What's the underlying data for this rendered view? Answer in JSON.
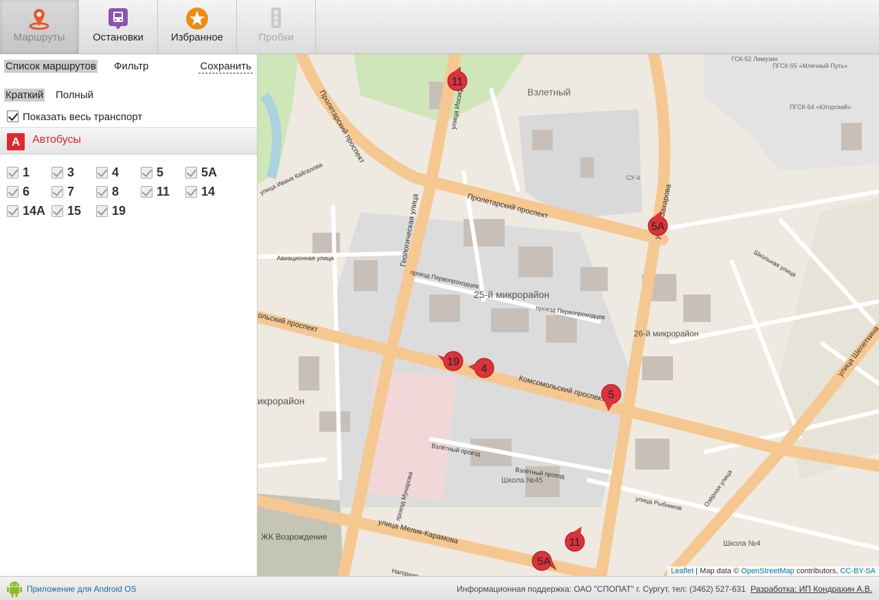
{
  "toolbar": {
    "tabs": [
      {
        "label": "Маршруты",
        "icon": "route-pin-icon"
      },
      {
        "label": "Остановки",
        "icon": "bus-stop-icon"
      },
      {
        "label": "Избранное",
        "icon": "star-icon"
      },
      {
        "label": "Пробки",
        "icon": "traffic-light-icon"
      }
    ]
  },
  "sidebar": {
    "list_tab": "Список маршрутов",
    "filter_tab": "Фильтр",
    "save_link": "Сохранить",
    "brief_tab": "Краткий",
    "full_tab": "Полный",
    "show_all_label": "Показать весь транспорт",
    "group": {
      "badge": "А",
      "name": "Автобусы"
    },
    "routes": [
      "1",
      "3",
      "4",
      "5",
      "5А",
      "6",
      "7",
      "8",
      "11",
      "14",
      "14А",
      "15",
      "19"
    ]
  },
  "map": {
    "labels": {
      "district_25": "25-й микрорайон",
      "district_26": "26-й микрорайон",
      "district_left": "икрорайон",
      "vzletny": "Взлетный",
      "proletarsky": "Пролетарский проспект",
      "proletarsky2": "Пролетарский проспект",
      "komsomolsky": "Комсомольский проспект",
      "komsomolsky_left": "ольский проспект",
      "geologicheskaya": "Геологическая улица",
      "zakharova": "улица Захарова",
      "melik": "улица Мелик-Карамова",
      "shepetkina": "улица Шепеткина",
      "aviatsionnaya": "Авиационная улица",
      "pervoprokhodtsev": "проезд Первопроходцев",
      "pervoprokhodtsev2": "проезд Первопроходцев",
      "vzletny_pr": "Взлётный проезд",
      "vzletny_pr2": "Взлётный проезд",
      "rybnikov": "улица Рыбников",
      "gsk52": "ГСК-52 Лимузин",
      "pgsk55": "ПГСК-55 «Млечный Путь»",
      "pgsk54": "ПГСК-54 «Югорский»",
      "zhk": "ЖК Возрождение",
      "school45": "Школа №45",
      "school4": "Школа №4",
      "su4": "СУ-4",
      "ozernaya": "Озёрная улица",
      "mukharova": "проезд Мунарова",
      "ioss": "улица Иосифа",
      "kaykalova": "улица Ивана Кайгалова",
      "shkolnaya": "Школьная улица",
      "nagornaya": "Нагорная"
    },
    "markers": [
      {
        "label": "11"
      },
      {
        "label": "5А"
      },
      {
        "label": "19"
      },
      {
        "label": "4"
      },
      {
        "label": "5"
      },
      {
        "label": "11"
      },
      {
        "label": "5А"
      }
    ],
    "attribution": {
      "leaflet": "Leaflet",
      "mapdata": " | Map data © ",
      "osm": "OpenStreetMap",
      "contrib": " contributors, ",
      "license": "CC-BY-SA"
    }
  },
  "footer": {
    "app_link": "Приложение для Android OS",
    "support": "Информационная поддержка: ОАО \"СПОПАТ\" г. Сургут, тел: (3462) 527-631",
    "developer": "Разработка: ИП Кондрахин А.В."
  }
}
